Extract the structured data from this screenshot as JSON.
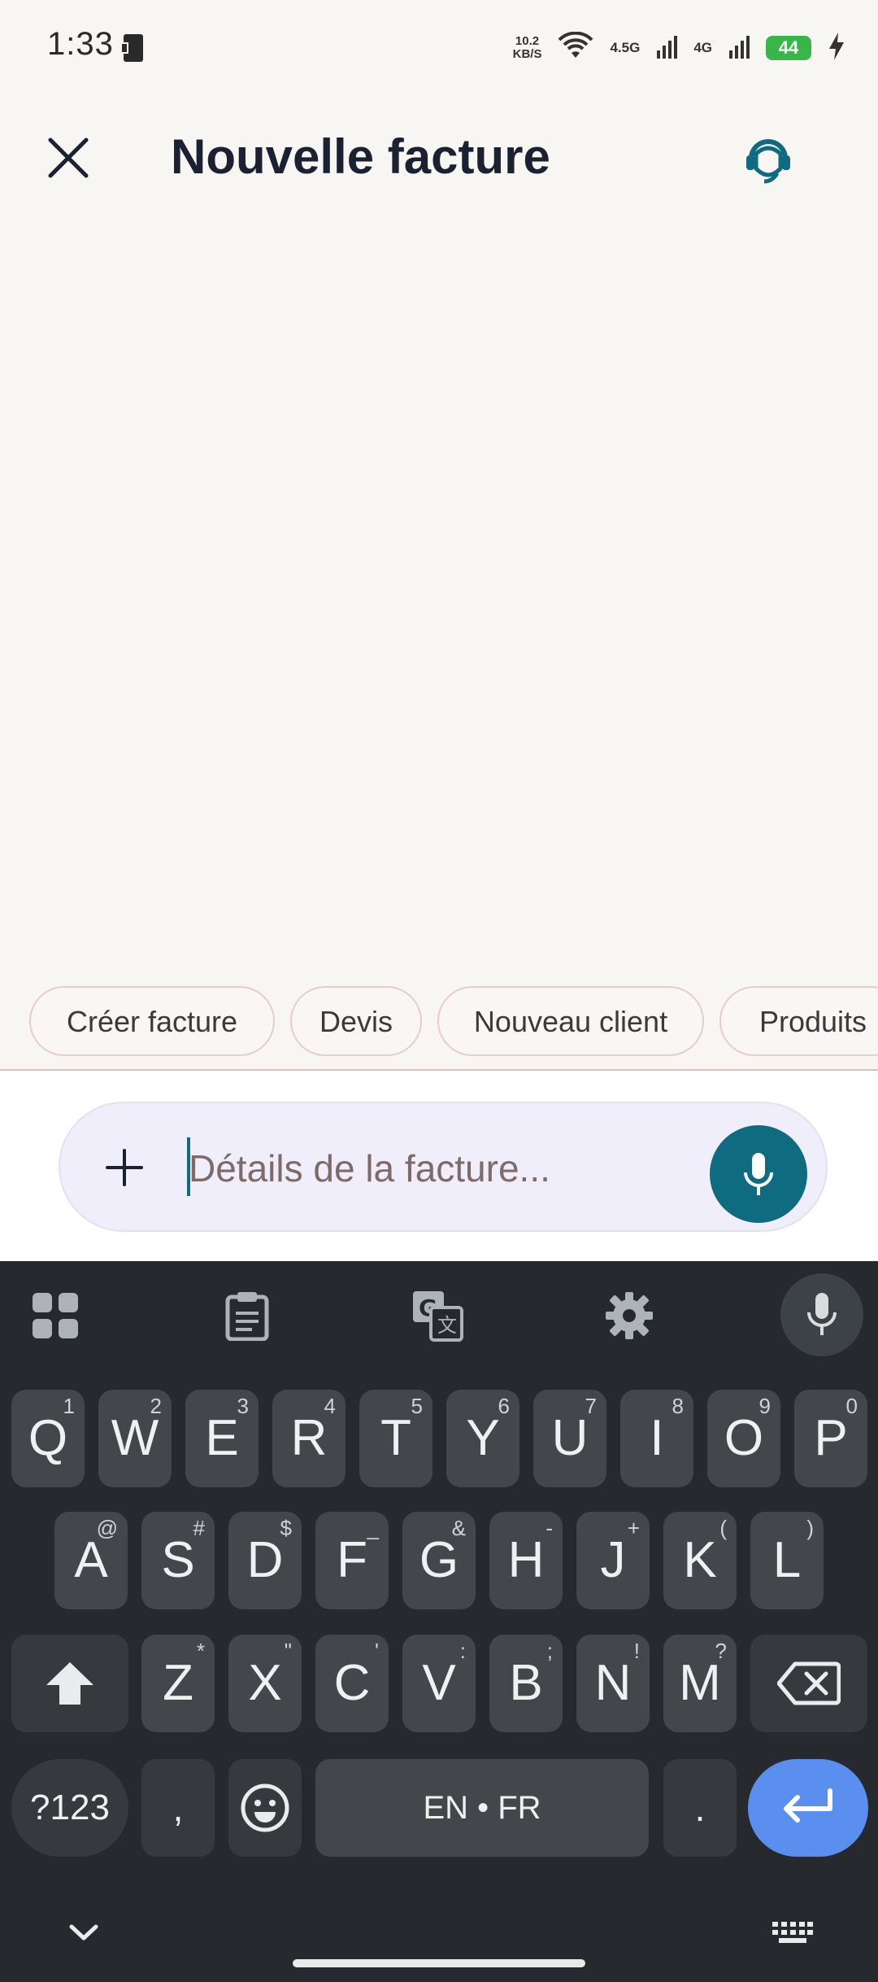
{
  "status_bar": {
    "time": "1:33",
    "net_speed_value": "10.2",
    "net_speed_unit": "KB/S",
    "network_label_1": "4.5G",
    "network_label_2": "4G",
    "battery": "44"
  },
  "header": {
    "title": "Nouvelle facture",
    "close_icon": "close-icon",
    "support_icon": "support-agent-icon"
  },
  "chips": [
    "Créer facture",
    "Devis",
    "Nouveau client",
    "Produits"
  ],
  "input": {
    "placeholder": "Détails de la facture...",
    "add_icon": "plus-icon",
    "mic_icon": "microphone-icon"
  },
  "colors": {
    "accent": "#0f6b80",
    "background": "#f8f6f3",
    "keyboard_bg": "#262a2e",
    "enter_key": "#5a8ff0"
  },
  "keyboard": {
    "toolbar": [
      "apps-grid-icon",
      "clipboard-icon",
      "translate-icon",
      "settings-gear-icon",
      "microphone-icon"
    ],
    "row1": [
      {
        "label": "Q",
        "hint": "1"
      },
      {
        "label": "W",
        "hint": "2"
      },
      {
        "label": "E",
        "hint": "3"
      },
      {
        "label": "R",
        "hint": "4"
      },
      {
        "label": "T",
        "hint": "5"
      },
      {
        "label": "Y",
        "hint": "6"
      },
      {
        "label": "U",
        "hint": "7"
      },
      {
        "label": "I",
        "hint": "8"
      },
      {
        "label": "O",
        "hint": "9"
      },
      {
        "label": "P",
        "hint": "0"
      }
    ],
    "row2": [
      {
        "label": "A",
        "hint": "@"
      },
      {
        "label": "S",
        "hint": "#"
      },
      {
        "label": "D",
        "hint": "$"
      },
      {
        "label": "F",
        "hint": "_"
      },
      {
        "label": "G",
        "hint": "&"
      },
      {
        "label": "H",
        "hint": "-"
      },
      {
        "label": "J",
        "hint": "+"
      },
      {
        "label": "K",
        "hint": "("
      },
      {
        "label": "L",
        "hint": ")"
      }
    ],
    "row3": [
      {
        "label": "Z",
        "hint": "*"
      },
      {
        "label": "X",
        "hint": "\""
      },
      {
        "label": "C",
        "hint": "'"
      },
      {
        "label": "V",
        "hint": ":"
      },
      {
        "label": "B",
        "hint": ";"
      },
      {
        "label": "N",
        "hint": "!"
      },
      {
        "label": "M",
        "hint": "?"
      }
    ],
    "symbols_key": "?123",
    "comma_key": ",",
    "space_key": "EN • FR",
    "period_key": ".",
    "shift_icon": "shift-icon",
    "backspace_icon": "backspace-icon",
    "emoji_icon": "emoji-icon",
    "enter_icon": "enter-icon",
    "hide_icon": "chevron-down-icon",
    "switch_icon": "keyboard-icon"
  }
}
